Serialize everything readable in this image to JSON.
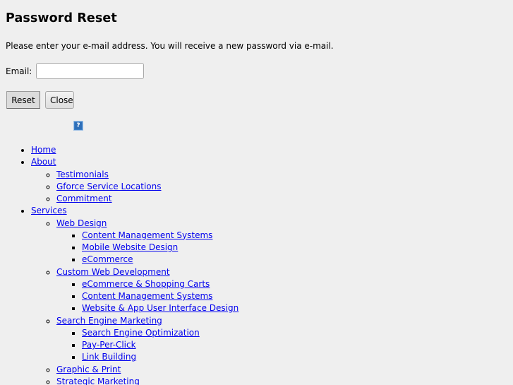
{
  "page": {
    "title": "Password Reset",
    "intro": "Please enter your e-mail address. You will receive a new password via e-mail."
  },
  "form": {
    "email_label": "Email:",
    "email_value": "",
    "email_placeholder": "",
    "reset_label": "Reset",
    "close_label": "Close"
  },
  "help_icon": {
    "glyph": "?",
    "icon": "help-icon"
  },
  "colors": {
    "background": "#efefef",
    "link": "#0000ee",
    "help_icon": "#3a7fc8"
  },
  "nav": {
    "home": "Home",
    "about": "About",
    "about_items": [
      "Testimonials",
      "Gforce Service Locations",
      "Commitment"
    ],
    "services": "Services",
    "web_design": "Web Design",
    "web_design_items": [
      "Content Management Systems",
      "Mobile Website Design",
      "eCommerce"
    ],
    "custom_dev": "Custom Web Development",
    "custom_dev_items": [
      "eCommerce & Shopping Carts",
      "Content Management Systems",
      "Website & App User Interface Design"
    ],
    "sem": "Search Engine Marketing",
    "sem_items": [
      "Search Engine Optimization",
      "Pay-Per-Click",
      "Link Building"
    ],
    "graphic_print": "Graphic & Print",
    "strategic_marketing": "Strategic Marketing"
  }
}
